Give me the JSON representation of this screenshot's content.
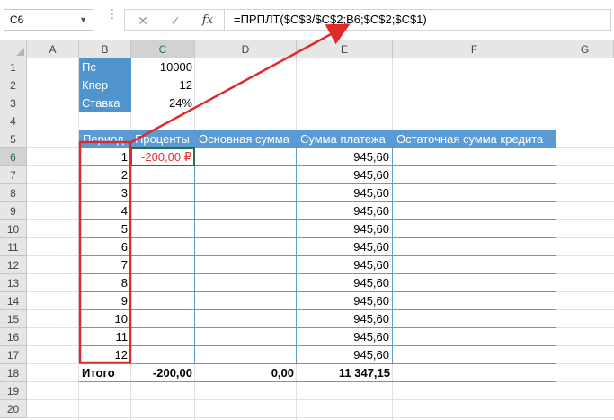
{
  "formula_bar": {
    "name_box": "C6",
    "cancel_icon": "close-icon",
    "enter_icon": "check-icon",
    "fx_label": "fx",
    "formula": "=ПРПЛТ($C$3/$C$2;B6;$C$2;$C$1)"
  },
  "columns": [
    "A",
    "B",
    "C",
    "D",
    "E",
    "F",
    "G"
  ],
  "rows": [
    "1",
    "2",
    "3",
    "4",
    "5",
    "6",
    "7",
    "8",
    "9",
    "10",
    "11",
    "12",
    "13",
    "14",
    "15",
    "16",
    "17",
    "18",
    "19",
    "20"
  ],
  "params": [
    {
      "label": "Пс",
      "value": "10000"
    },
    {
      "label": "Кпер",
      "value": "12"
    },
    {
      "label": "Ставка",
      "value": "24%"
    }
  ],
  "table": {
    "headers": [
      "Период",
      "Проценты",
      "Основная сумма",
      "Сумма платежа",
      "Остаточная сумма кредита"
    ],
    "rows": [
      {
        "period": "1",
        "interest": "-200,00 ₽",
        "principal": "",
        "payment": "945,60",
        "balance": ""
      },
      {
        "period": "2",
        "interest": "",
        "principal": "",
        "payment": "945,60",
        "balance": ""
      },
      {
        "period": "3",
        "interest": "",
        "principal": "",
        "payment": "945,60",
        "balance": ""
      },
      {
        "period": "4",
        "interest": "",
        "principal": "",
        "payment": "945,60",
        "balance": ""
      },
      {
        "period": "5",
        "interest": "",
        "principal": "",
        "payment": "945,60",
        "balance": ""
      },
      {
        "period": "6",
        "interest": "",
        "principal": "",
        "payment": "945,60",
        "balance": ""
      },
      {
        "period": "7",
        "interest": "",
        "principal": "",
        "payment": "945,60",
        "balance": ""
      },
      {
        "period": "8",
        "interest": "",
        "principal": "",
        "payment": "945,60",
        "balance": ""
      },
      {
        "period": "9",
        "interest": "",
        "principal": "",
        "payment": "945,60",
        "balance": ""
      },
      {
        "period": "10",
        "interest": "",
        "principal": "",
        "payment": "945,60",
        "balance": ""
      },
      {
        "period": "11",
        "interest": "",
        "principal": "",
        "payment": "945,60",
        "balance": ""
      },
      {
        "period": "12",
        "interest": "",
        "principal": "",
        "payment": "945,60",
        "balance": ""
      }
    ],
    "totals": {
      "label": "Итого",
      "interest": "-200,00",
      "principal": "0,00",
      "payment": "11 347,15"
    }
  },
  "colors": {
    "header_blue": "#5b9bd5",
    "param_blue": "#4f94cd",
    "highlight_red": "#e03030",
    "excel_green": "#217346"
  }
}
